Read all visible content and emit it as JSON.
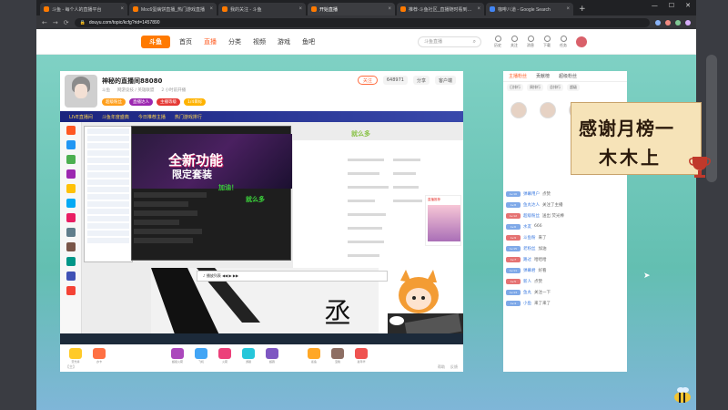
{
  "browser": {
    "tabs": [
      {
        "label": "斗鱼 - 每个人的直播平台",
        "color": "#ff7a00"
      },
      {
        "label": "Moc6蛋病饼直播_热门游戏直播",
        "color": "#ff7a00"
      },
      {
        "label": "我的关注 - 斗鱼",
        "color": "#ff7a00"
      },
      {
        "label": "开始直播",
        "color": "#ff7a00"
      },
      {
        "label": "推荐-斗鱼社区_直播随时看到最新",
        "color": "#ff7a00"
      },
      {
        "label": "咖啡八道 - Google Search",
        "color": "#4285f4"
      }
    ],
    "url": "douyu.com/topic/kcfg?rid=1457890",
    "window_controls": [
      "—",
      "☐",
      "✕"
    ]
  },
  "site": {
    "logo": "斗鱼",
    "nav": [
      "首页",
      "直播",
      "分类",
      "视频",
      "游戏",
      "鱼吧"
    ],
    "active_nav": 1,
    "search_placeholder": "斗鱼直播",
    "header_icons": [
      "历史",
      "关注",
      "消息",
      "下载",
      "任务"
    ]
  },
  "streamer": {
    "name": "神秘的直播间88080",
    "meta": [
      "斗鱼",
      "网游竞技 / 英雄联盟",
      "2 小时前开播"
    ],
    "badges": [
      {
        "label": "超级粉丝",
        "color": "#ff9f1c"
      },
      {
        "label": "直播达人",
        "color": "#9c27b0"
      },
      {
        "label": "主播等级",
        "color": "#e53935"
      },
      {
        "label": "1/4目标",
        "color": "#ffb300"
      }
    ],
    "follow": "关注",
    "follow_count": "648971",
    "share": "分享",
    "client": "客户端"
  },
  "video": {
    "top_strip": [
      "LIVE直播间",
      "斗鱼年度盛典",
      "今日推荐主播",
      "热门游戏排行"
    ],
    "banner_line1": "全新功能",
    "banner_line2": "限定套装",
    "green1": "加油！",
    "green2": "就么多",
    "green3": "就么多",
    "music_controls": "♪  播放列表    ◀◀   ▶   ▶▶"
  },
  "gifts": {
    "items": [
      "荧光棒",
      "办卡",
      "超级火箭",
      "飞机",
      "火箭",
      "游艇",
      "超跑",
      "鲨鱼",
      "宝箱",
      "嘉年华"
    ],
    "left": "【主】",
    "right": [
      "帮助",
      "反馈"
    ]
  },
  "chat": {
    "tabs": [
      "主播粉丝",
      "贡献榜",
      "超级粉丝"
    ],
    "chips": [
      "日排行",
      "周排行",
      "总排行",
      "超级"
    ],
    "rows": [
      {
        "lv": "Lv.10",
        "name": "弹幕用户",
        "msg": "点赞"
      },
      {
        "lv": "Lv.8",
        "name": "鱼丸达人",
        "msg": "关注了主播"
      },
      {
        "lv": "Lv.12",
        "name": "超级粉丝",
        "msg": "送出 荧光棒"
      },
      {
        "lv": "Lv.6",
        "name": "水友",
        "msg": "666"
      },
      {
        "lv": "Lv.9",
        "name": "斗鱼粉",
        "msg": "来了"
      },
      {
        "lv": "Lv.15",
        "name": "老粉丝",
        "msg": "加油"
      },
      {
        "lv": "Lv.7",
        "name": "路过",
        "msg": "哈哈哈"
      },
      {
        "lv": "Lv.11",
        "name": "弹幕君",
        "msg": "好看"
      },
      {
        "lv": "Lv.5",
        "name": "新人",
        "msg": "点赞"
      },
      {
        "lv": "Lv.13",
        "name": "鱼丸",
        "msg": "关注一下"
      },
      {
        "lv": "Lv.4",
        "name": "小鱼",
        "msg": "来了来了"
      }
    ]
  },
  "overlay": {
    "line1": "感谢月榜一",
    "line2": "木木上"
  }
}
